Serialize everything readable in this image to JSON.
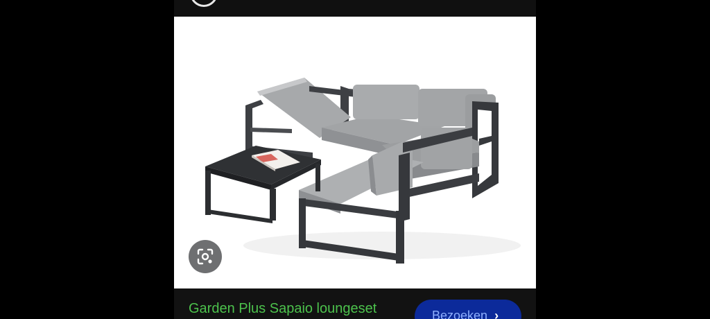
{
  "result": {
    "title": "Garden Plus Sapaio loungeset",
    "visit_label": "Bezoeken",
    "visit_icon": "chevron-right-icon"
  },
  "image": {
    "subject": "loungeset-photo"
  },
  "icons": {
    "lens": "camera-search-icon",
    "top_avatar": "source-logo-icon"
  },
  "colors": {
    "title": "#4cc24c",
    "visit_button": "#0c2a9a",
    "visit_text": "#8fb0ff",
    "lens_button": "#6e6f71"
  }
}
